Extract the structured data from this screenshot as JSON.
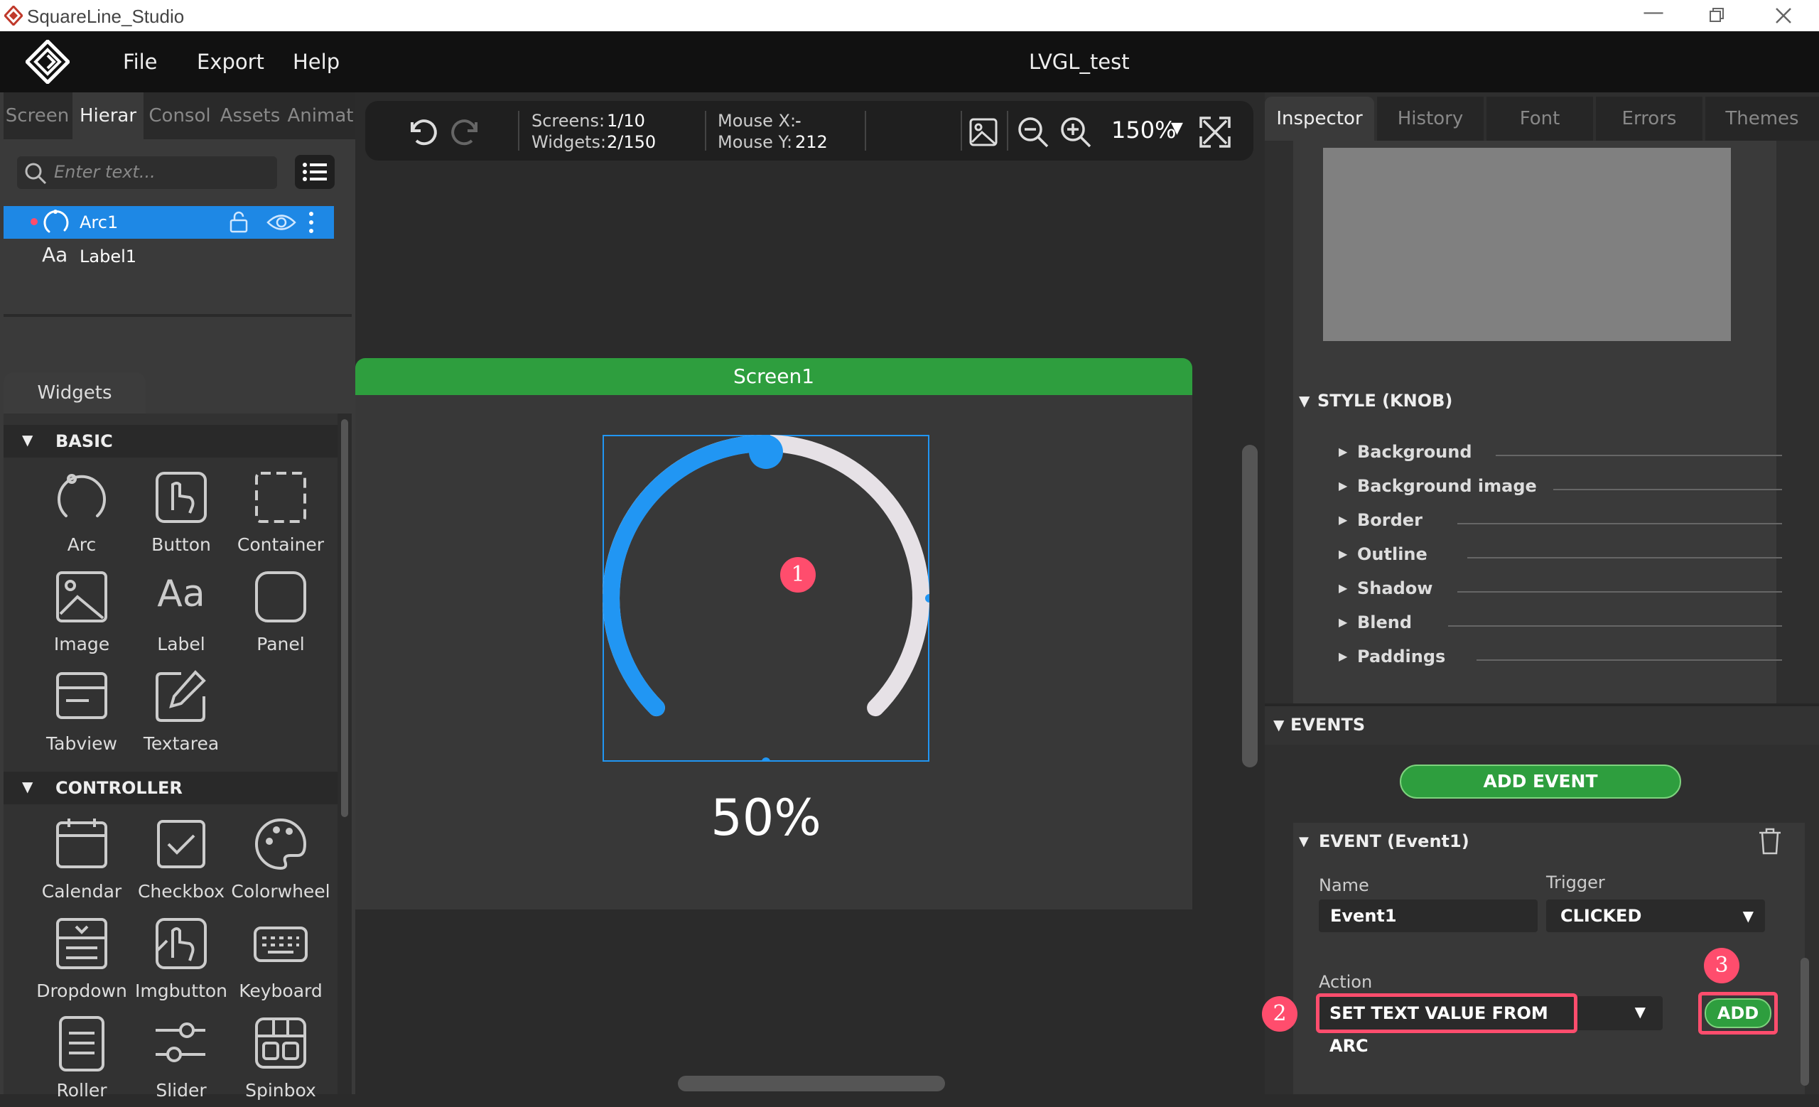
{
  "window": {
    "title": "SquareLine_Studio",
    "project": "LVGL_test"
  },
  "menu": [
    "File",
    "Export",
    "Help"
  ],
  "left_tabs": [
    "Screen",
    "Hierar",
    "Consol",
    "Assets",
    "Animat"
  ],
  "search": {
    "placeholder": "Enter text..."
  },
  "hierarchy": [
    {
      "name": "Arc1"
    },
    {
      "name": "Label1"
    }
  ],
  "widgets_tab": "Widgets",
  "categories": {
    "basic": {
      "title": "BASIC",
      "items": [
        "Arc",
        "Button",
        "Container",
        "Image",
        "Label",
        "Panel",
        "Tabview",
        "Textarea"
      ]
    },
    "controller": {
      "title": "CONTROLLER",
      "items": [
        "Calendar",
        "Checkbox",
        "Colorwheel",
        "Dropdown",
        "Imgbutton",
        "Keyboard",
        "Roller",
        "Slider",
        "Spinbox"
      ]
    }
  },
  "toolbar": {
    "screens_label": "Screens:",
    "screens_value": "1/10",
    "widgets_label": "Widgets:",
    "widgets_value": "2/150",
    "mousex_label": "Mouse X:",
    "mousex_value": "-",
    "mousey_label": "Mouse Y:",
    "mousey_value": "212",
    "zoom": "150%"
  },
  "screen": {
    "name": "Screen1",
    "arc_value": 50,
    "label_text": "50%"
  },
  "right_tabs": [
    "Inspector",
    "History",
    "Font",
    "Errors",
    "Themes"
  ],
  "style_knob": {
    "title": "STYLE (KNOB)",
    "props": [
      "Background",
      "Background image",
      "Border",
      "Outline",
      "Shadow",
      "Blend",
      "Paddings"
    ]
  },
  "events": {
    "title": "EVENTS",
    "add_event": "ADD EVENT",
    "event_title": "EVENT (Event1)",
    "name_label": "Name",
    "name_value": "Event1",
    "trigger_label": "Trigger",
    "trigger_value": "CLICKED",
    "action_label": "Action",
    "action_value": "SET TEXT VALUE FROM ARC",
    "add": "ADD"
  },
  "badges": [
    "1",
    "2",
    "3"
  ],
  "colors": {
    "accent": "#1e88e5",
    "green": "#2e9e3e",
    "highlight": "#ff4d6d"
  }
}
